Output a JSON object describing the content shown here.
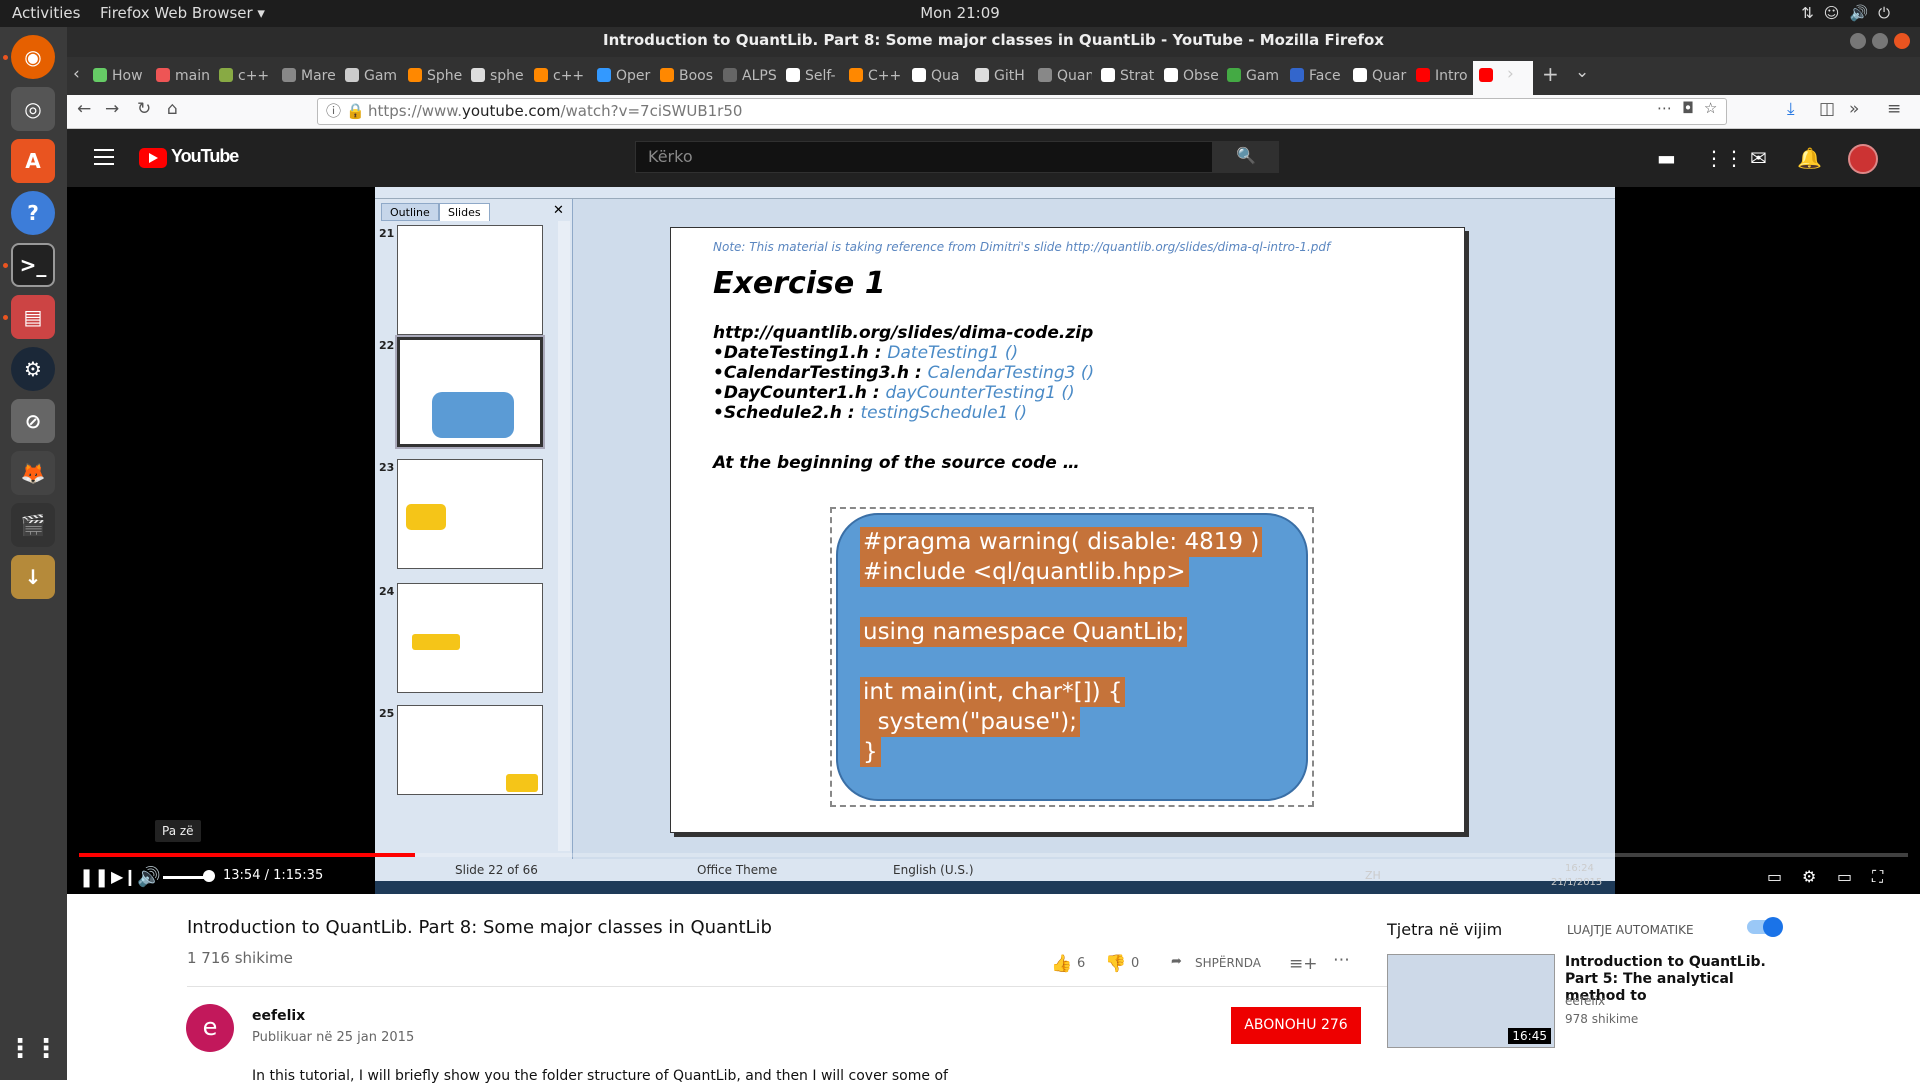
{
  "system": {
    "activities": "Activities",
    "app_name": "Firefox Web Browser ▾",
    "clock": "Mon 21:09",
    "tray_icons": [
      "network-icon",
      "accessibility-icon",
      "volume-icon",
      "power-icon"
    ]
  },
  "window": {
    "title": "Introduction to QuantLib. Part 8: Some major classes in QuantLib - YouTube - Mozilla Firefox"
  },
  "tabs": [
    {
      "label": "How",
      "color": "#6c6"
    },
    {
      "label": "main",
      "color": "#e55"
    },
    {
      "label": "c++ -",
      "color": "#8a4"
    },
    {
      "label": "MarekK",
      "color": "#888"
    },
    {
      "label": "Gam",
      "color": "#ccc"
    },
    {
      "label": "Sphe",
      "color": "#f80"
    },
    {
      "label": "sphe",
      "color": "#ddd"
    },
    {
      "label": "c++ -",
      "color": "#f80"
    },
    {
      "label": "Oper",
      "color": "#39f"
    },
    {
      "label": "Boos",
      "color": "#f80"
    },
    {
      "label": "ALPS - A",
      "color": "#666"
    },
    {
      "label": "Self-",
      "color": "#fff"
    },
    {
      "label": "C++ I",
      "color": "#f80"
    },
    {
      "label": "Qua",
      "color": "#fff"
    },
    {
      "label": "GitH",
      "color": "#ddd"
    },
    {
      "label": "QuantLi",
      "color": "#888"
    },
    {
      "label": "Strat",
      "color": "#fff"
    },
    {
      "label": "Obse",
      "color": "#fff"
    },
    {
      "label": "Gam",
      "color": "#4a4"
    },
    {
      "label": "Face",
      "color": "#36c"
    },
    {
      "label": "Quar",
      "color": "#fff"
    },
    {
      "label": "Intro",
      "color": "#f00"
    },
    {
      "label": "",
      "color": "#f00"
    }
  ],
  "nav": {
    "url_prefix": "https://www.",
    "url_domain": "youtube.com",
    "url_path": "/watch?v=7ciSWUB1r50"
  },
  "youtube": {
    "brand": "YouTube",
    "search_placeholder": "Kërko"
  },
  "slide_app": {
    "tab_outline": "Outline",
    "tab_slides": "Slides",
    "thumb_numbers": [
      "21",
      "22",
      "23",
      "24",
      "25"
    ],
    "status_slide": "Slide 22 of 66",
    "status_theme": "Office Theme",
    "status_lang": "English (U.S.)",
    "taskbar_lang": "ZH",
    "taskbar_time": "16:24",
    "taskbar_date": "21/1/2015"
  },
  "slide": {
    "note": "Note: This material is taking reference from Dimitri's slide http://quantlib.org/slides/dima-ql-intro-1.pdf",
    "title": "Exercise 1",
    "url_line": "http://quantlib.org/slides/dima-code.zip",
    "items": [
      {
        "file": "•DateTesting1.h : ",
        "func": "DateTesting1 ()"
      },
      {
        "file": "•CalendarTesting3.h : ",
        "func": "CalendarTesting3 ()"
      },
      {
        "file": "•DayCounter1.h : ",
        "func": "dayCounterTesting1 ()"
      },
      {
        "file": "•Schedule2.h : ",
        "func": "testingSchedule1 ()"
      }
    ],
    "begin_line": "At the beginning of the source code …",
    "code": [
      "#pragma warning( disable: 4819 )",
      "#include <ql/quantlib.hpp>",
      "using namespace QuantLib;",
      "int main(int, char*[]) {",
      "  system(\"pause\");",
      "}"
    ]
  },
  "player": {
    "tooltip": "Pa zë",
    "time": "13:54 / 1:15:35",
    "progress_fraction": 0.1837
  },
  "video": {
    "title": "Introduction to QuantLib. Part 8: Some major classes in QuantLib",
    "views": "1 716 shikime",
    "likes": "6",
    "dislikes": "0",
    "share": "SHPËRNDA",
    "channel_initial": "e",
    "channel": "eefelix",
    "published": "Publikuar në 25 jan 2015",
    "subscribe": "ABONOHU  276",
    "description": "In this tutorial, I will briefly show you the folder structure of QuantLib, and then I will cover some of"
  },
  "sidebar": {
    "up_next": "Tjetra në vijim",
    "autoplay": "LUAJTJE AUTOMATIKE",
    "next_title": "Introduction to QuantLib. Part 5: The analytical method to",
    "next_channel": "eefelix",
    "next_views": "978 shikime",
    "next_duration": "16:45"
  }
}
